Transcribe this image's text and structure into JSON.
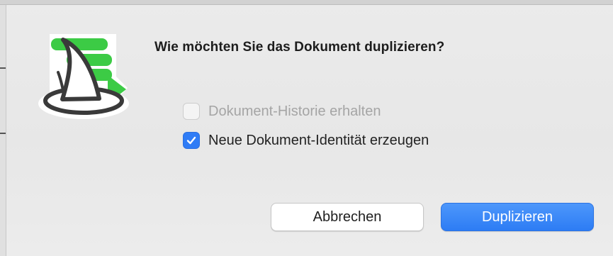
{
  "dialog": {
    "icon": "wizard-hat-icon",
    "title": "Wie möchten Sie das Dokument duplizieren?",
    "options": [
      {
        "label": "Dokument-Historie erhalten",
        "checked": false,
        "enabled": false
      },
      {
        "label": "Neue Dokument-Identität erzeugen",
        "checked": true,
        "enabled": true
      }
    ],
    "buttons": {
      "cancel": "Abbrechen",
      "primary": "Duplizieren"
    }
  },
  "colors": {
    "accent": "#2f7cf6",
    "icon_green": "#3ccb45",
    "background": "#e9e9e9"
  }
}
